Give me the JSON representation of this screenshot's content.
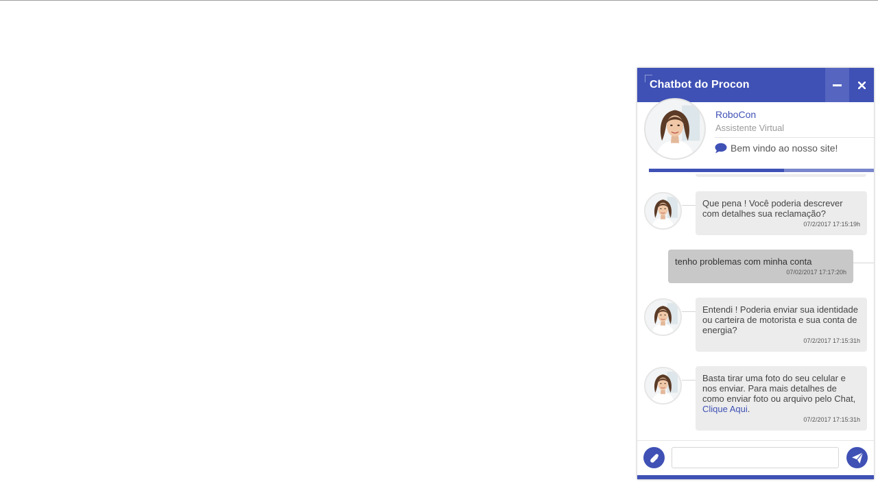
{
  "widget": {
    "title": "Chatbot do Procon",
    "bot_name": "RoboCon",
    "bot_role": "Assistente Virtual",
    "welcome": "Bem vindo ao nosso site!",
    "progress": 0.6,
    "accent_color": "#3f51b5"
  },
  "messages": [
    {
      "from": "bot",
      "text": "Que pena ! Você poderia descrever com detalhes sua reclamação?",
      "time": "07/2/2017 17:15:19h"
    },
    {
      "from": "user",
      "text": "tenho problemas com minha conta",
      "time": "07/02/2017 17:17:20h"
    },
    {
      "from": "bot",
      "text": "Entendi ! Poderia enviar sua identidade ou carteira de motorista e sua conta de energia?",
      "time": "07/2/2017 17:15:31h"
    },
    {
      "from": "bot",
      "text": "Basta tirar uma foto do seu celular e nos enviar. Para mais detalhes de como enviar foto ou arquivo pelo Chat,",
      "link": "Clique Aqui",
      "link_suffix": ".",
      "time": "07/2/2017 17:15:31h"
    }
  ],
  "composer": {
    "input_value": "",
    "placeholder": "",
    "attach_icon": "paperclip-icon",
    "send_icon": "paper-plane-icon"
  }
}
